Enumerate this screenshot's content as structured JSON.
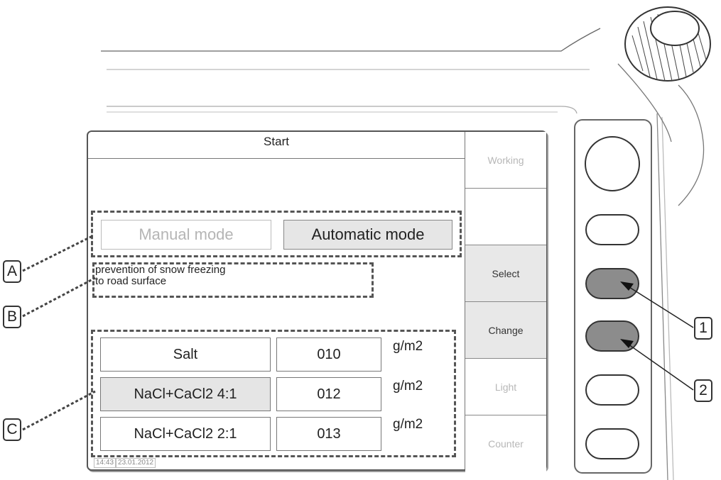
{
  "screen": {
    "title": "Start",
    "mode_buttons": {
      "manual": "Manual mode",
      "automatic": "Automatic mode",
      "active": "automatic"
    },
    "description": [
      "prevention of snow freezing",
      "to road surface"
    ],
    "materials": [
      {
        "name": "Salt",
        "value": "010",
        "unit": "g/m2",
        "selected": false
      },
      {
        "name": "NaCl+CaCl2 4:1",
        "value": "012",
        "unit": "g/m2",
        "selected": true
      },
      {
        "name": "NaCl+CaCl2 2:1",
        "value": "013",
        "unit": "g/m2",
        "selected": false
      }
    ],
    "time": "14:43",
    "date": "23.01.2012"
  },
  "softkeys": [
    {
      "label": "Working",
      "active": false
    },
    {
      "label": "",
      "active": false
    },
    {
      "label": "Select",
      "active": true
    },
    {
      "label": "Change",
      "active": true
    },
    {
      "label": "Light",
      "active": false
    },
    {
      "label": "Counter",
      "active": false
    }
  ],
  "callouts": {
    "a": "A",
    "b": "B",
    "c": "C",
    "one": "1",
    "two": "2"
  },
  "colors": {
    "active_softkey": "#e8e8e8",
    "pressed_key": "#8c8c8c",
    "dim_text": "#b7b7b7"
  }
}
